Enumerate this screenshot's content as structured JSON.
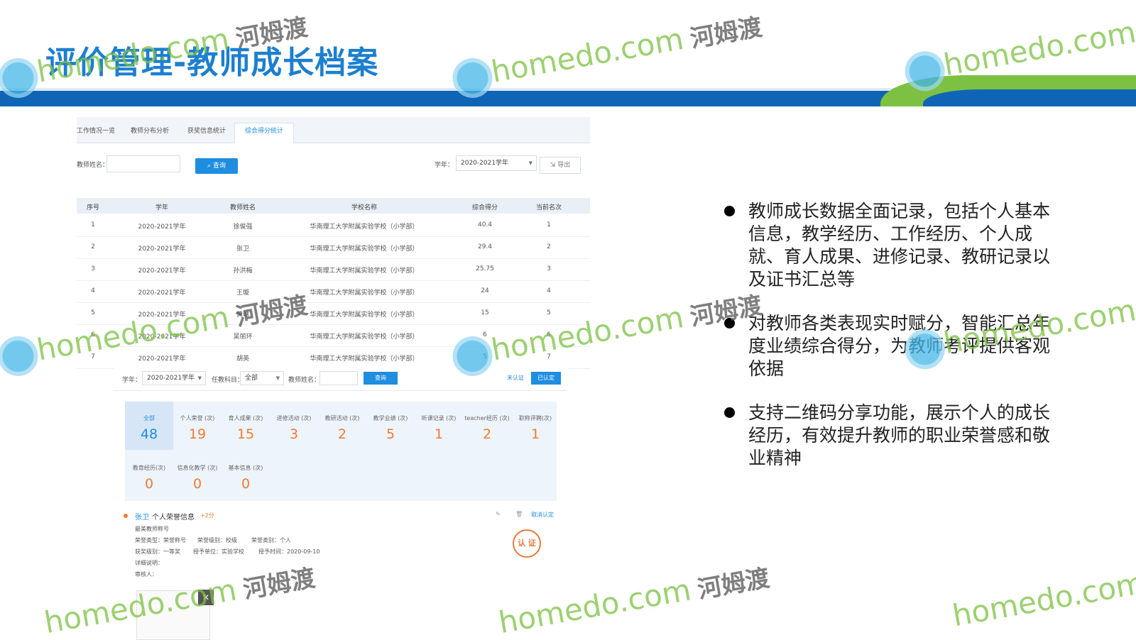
{
  "slide": {
    "title": "评价管理-教师成长档案",
    "bullets": [
      "教师成长数据全面记录，包括个人基本信息，教学经历、工作经历、个人成就、育人成果、进修记录、教研记录以及证书汇总等",
      "对教师各类表现实时赋分，智能汇总年度业绩综合得分，为教师考评提供客观依据",
      "支持二维码分享功能，展示个人的成长经历，有效提升教师的职业荣誉感和敬业精神"
    ]
  },
  "watermark": {
    "latin": "homedo.com",
    "chinese": "河姆渡"
  },
  "app": {
    "tabs": [
      "工作情况一览",
      "教师分布分析",
      "获奖信息统计",
      "综合得分统计"
    ],
    "active_tab": 3,
    "filters": {
      "name_label": "教师姓名：",
      "name_value": "",
      "query_label": "查询",
      "year_label": "学年：",
      "year_value": "2020-2021学年",
      "export_label": "导出"
    },
    "table": {
      "columns": [
        "序号",
        "学年",
        "教师姓名",
        "学校名称",
        "综合得分",
        "当前名次"
      ],
      "rows": [
        [
          "1",
          "2020-2021学年",
          "徐俊强",
          "华南理工大学附属实验学校（小学部）",
          "40.4",
          "1"
        ],
        [
          "2",
          "2020-2021学年",
          "张卫",
          "华南理工大学附属实验学校（小学部）",
          "29.4",
          "2"
        ],
        [
          "3",
          "2020-2021学年",
          "孙洪梅",
          "华南理工大学附属实验学校（小学部）",
          "25.75",
          "3"
        ],
        [
          "4",
          "2020-2021学年",
          "王璇",
          "华南理工大学附属实验学校（小学部）",
          "24",
          "4"
        ],
        [
          "5",
          "2020-2021学年",
          "黄琳",
          "华南理工大学附属实验学校（小学部）",
          "15",
          "5"
        ],
        [
          "6",
          "2020-2021学年",
          "吴丽环",
          "华南理工大学附属实验学校（小学部）",
          "6",
          "6"
        ],
        [
          "7",
          "2020-2021学年",
          "胡英",
          "华南理工大学附属实验学校（小学部）",
          "5",
          "7"
        ]
      ]
    },
    "panel": {
      "year_label": "学年：",
      "year_value": "2020-2021学年",
      "subject_label": "任教科目：",
      "subject_value": "全部",
      "name_label": "教师姓名：",
      "query_label": "查询",
      "unverified_label": "未认证",
      "verified_label": "已认定",
      "stats": [
        {
          "label": "全部",
          "value": "48"
        },
        {
          "label": "个人荣誉 (次)",
          "value": "19"
        },
        {
          "label": "育人成果 (次)",
          "value": "15"
        },
        {
          "label": "进修活动 (次)",
          "value": "3"
        },
        {
          "label": "教研活动 (次)",
          "value": "2"
        },
        {
          "label": "教学业绩 (次)",
          "value": "5"
        },
        {
          "label": "听课记录 (次)",
          "value": "1"
        },
        {
          "label": "teacher经历 (次)",
          "value": "2"
        },
        {
          "label": "职称评聘(次)",
          "value": "1"
        },
        {
          "label": "教育经历(次)",
          "value": "0"
        },
        {
          "label": "信息化教学 (次)",
          "value": "0"
        },
        {
          "label": "基本信息 (次)",
          "value": "0"
        }
      ],
      "honor": {
        "teacher": "张卫",
        "title": "个人荣誉信息",
        "score": "+2分",
        "cancel_label": "取消认定",
        "item_name": "最美教师称号",
        "honor_type": "荣誉类型：荣誉称号",
        "honor_level": "荣誉级别：校级",
        "honor_category": "荣誉类别：个人",
        "award_level": "获奖级别：一等奖",
        "award_unit": "授予单位：实验学校",
        "award_time": "授予时间：2020-09-10",
        "detail_label": "详细说明：",
        "reviewer_label": "审核人：",
        "seal_text": "认 证"
      }
    }
  }
}
